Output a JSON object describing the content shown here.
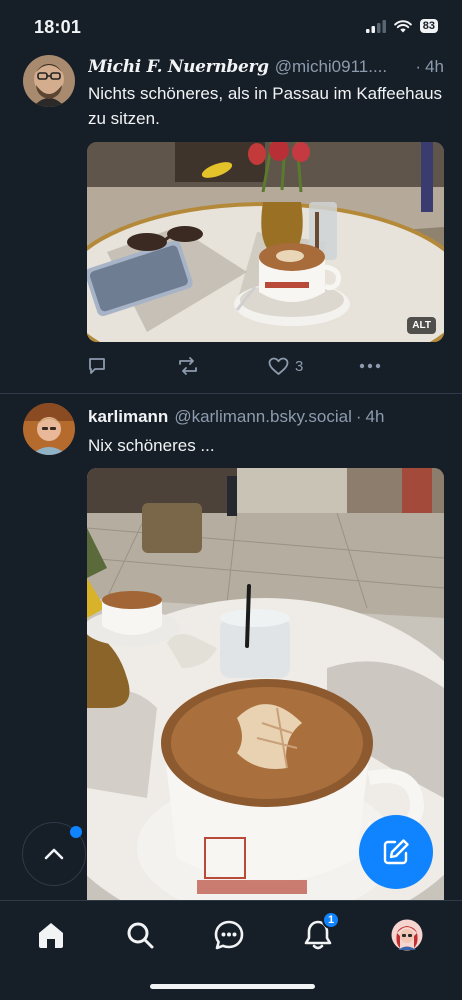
{
  "status_bar": {
    "time": "18:01",
    "battery": "83"
  },
  "posts": [
    {
      "display_name": "Michi F. Nuernberg",
      "handle": "@michi0911....",
      "separator": "·",
      "time": "4h",
      "text": "Nichts schöneres, als in Passau im Kaffeehaus zu sitzen.",
      "image_alt_badge": "ALT",
      "like_count": "3"
    },
    {
      "display_name": "karlimann",
      "handle": "@karlimann.bsky.social",
      "separator": "·",
      "time": "4h",
      "text": "Nix schöneres ..."
    }
  ],
  "tab_bar": {
    "notifications_badge": "1"
  },
  "colors": {
    "background": "#161e27",
    "accent": "#1083fe",
    "muted": "#8c9bad",
    "divider": "#2e3a47"
  }
}
